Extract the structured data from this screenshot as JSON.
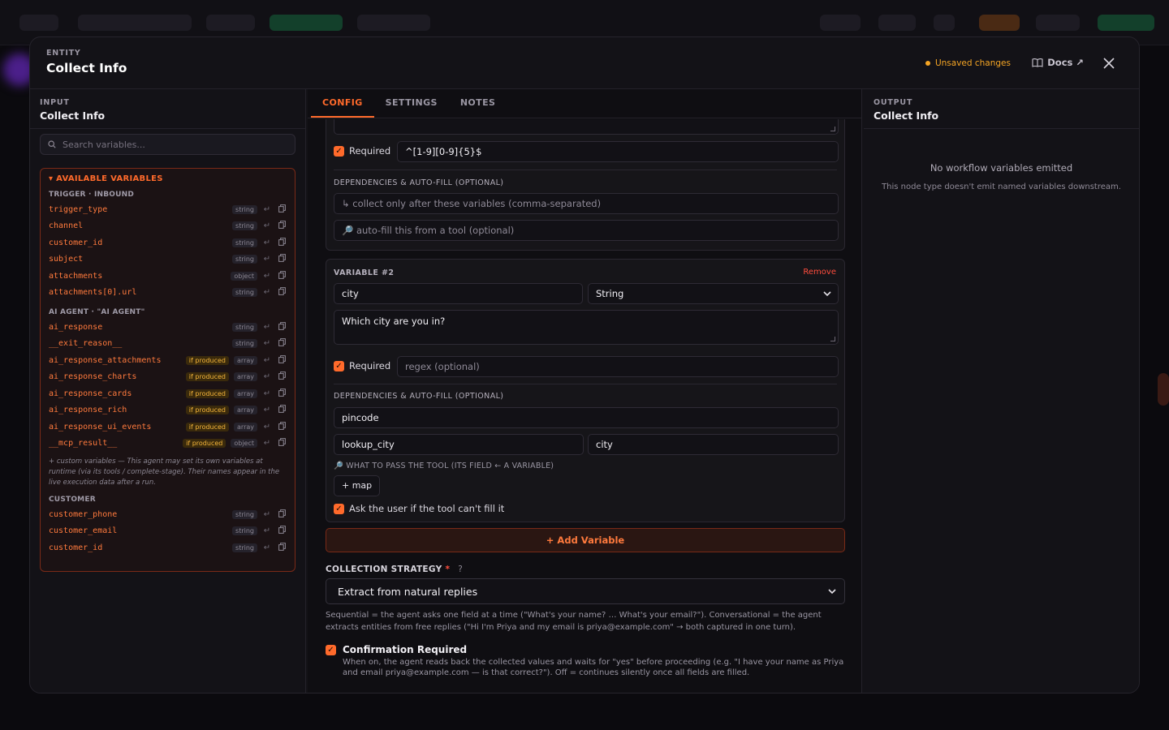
{
  "modal": {
    "kicker": "ENTITY",
    "title": "Collect Info",
    "unsaved": "Unsaved changes",
    "docs": "Docs ↗"
  },
  "input": {
    "kicker": "INPUT",
    "title": "Collect Info",
    "search_placeholder": "Search variables...",
    "available_header": "▾ AVAILABLE VARIABLES",
    "groups": [
      {
        "label": "TRIGGER · INBOUND",
        "vars": [
          {
            "name": "trigger_type",
            "type": "string",
            "produced": ""
          },
          {
            "name": "channel",
            "type": "string",
            "produced": ""
          },
          {
            "name": "customer_id",
            "type": "string",
            "produced": ""
          },
          {
            "name": "subject",
            "type": "string",
            "produced": ""
          },
          {
            "name": "attachments",
            "type": "object",
            "produced": ""
          },
          {
            "name": "attachments[0].url",
            "type": "string",
            "produced": ""
          }
        ]
      },
      {
        "label": "AI AGENT · \"AI AGENT\"",
        "vars": [
          {
            "name": "ai_response",
            "type": "string",
            "produced": ""
          },
          {
            "name": "__exit_reason__",
            "type": "string",
            "produced": ""
          },
          {
            "name": "ai_response_attachments",
            "type": "array",
            "produced": "if produced"
          },
          {
            "name": "ai_response_charts",
            "type": "array",
            "produced": "if produced"
          },
          {
            "name": "ai_response_cards",
            "type": "array",
            "produced": "if produced"
          },
          {
            "name": "ai_response_rich",
            "type": "array",
            "produced": "if produced"
          },
          {
            "name": "ai_response_ui_events",
            "type": "array",
            "produced": "if produced"
          },
          {
            "name": "__mcp_result__",
            "type": "object",
            "produced": "if produced"
          }
        ]
      },
      {
        "label": "CUSTOMER",
        "vars": [
          {
            "name": "customer_phone",
            "type": "string",
            "produced": ""
          },
          {
            "name": "customer_email",
            "type": "string",
            "produced": ""
          },
          {
            "name": "customer_id",
            "type": "string",
            "produced": ""
          }
        ]
      }
    ],
    "custom_note": "+ custom variables — This agent may set its own variables at runtime (via its tools / complete-stage). Their names appear in the live execution data after a run."
  },
  "tabs": [
    "CONFIG",
    "SETTINGS",
    "NOTES"
  ],
  "var1": {
    "required_label": "Required",
    "regex": "^[1-9][0-9]{5}$",
    "deps_label": "DEPENDENCIES & AUTO-FILL (OPTIONAL)",
    "deps_placeholder": "↳ collect only after these variables (comma-separated)",
    "autofill_placeholder": "🔎 auto-fill this from a tool (optional)"
  },
  "var2": {
    "title": "VARIABLE #2",
    "remove": "Remove",
    "name": "city",
    "type": "String",
    "prompt": "Which city are you in?",
    "required_label": "Required",
    "regex_placeholder": "regex (optional)",
    "deps_label": "DEPENDENCIES & AUTO-FILL (OPTIONAL)",
    "deps_value": "pincode",
    "tool": "lookup_city",
    "tool_field": "city",
    "pass_hint": "🔎 WHAT TO PASS THE TOOL (ITS FIELD ← A VARIABLE)",
    "map_button": "+ map",
    "ask_user_label": "Ask the user if the tool can't fill it"
  },
  "add_variable": "+ Add Variable",
  "strategy": {
    "label": "COLLECTION STRATEGY",
    "required_mark": "*",
    "help": "?",
    "value": "Extract from natural replies",
    "description": "Sequential = the agent asks one field at a time (\"What's your name? … What's your email?\"). Conversational = the agent extracts entities from free replies (\"Hi I'm Priya and my email is priya@example.com\" → both captured in one turn)."
  },
  "confirmation": {
    "title": "Confirmation Required",
    "description": "When on, the agent reads back the collected values and waits for \"yes\" before proceeding (e.g. \"I have your name as Priya and email priya@example.com — is that correct?\"). Off = continues silently once all fields are filled."
  },
  "output": {
    "kicker": "OUTPUT",
    "title": "Collect Info",
    "empty_title": "No workflow variables emitted",
    "empty_sub": "This node type doesn't emit named variables downstream."
  },
  "colors": {
    "accent": "#ff6a2b",
    "warning": "#f5a524",
    "danger": "#ff4d3d"
  }
}
